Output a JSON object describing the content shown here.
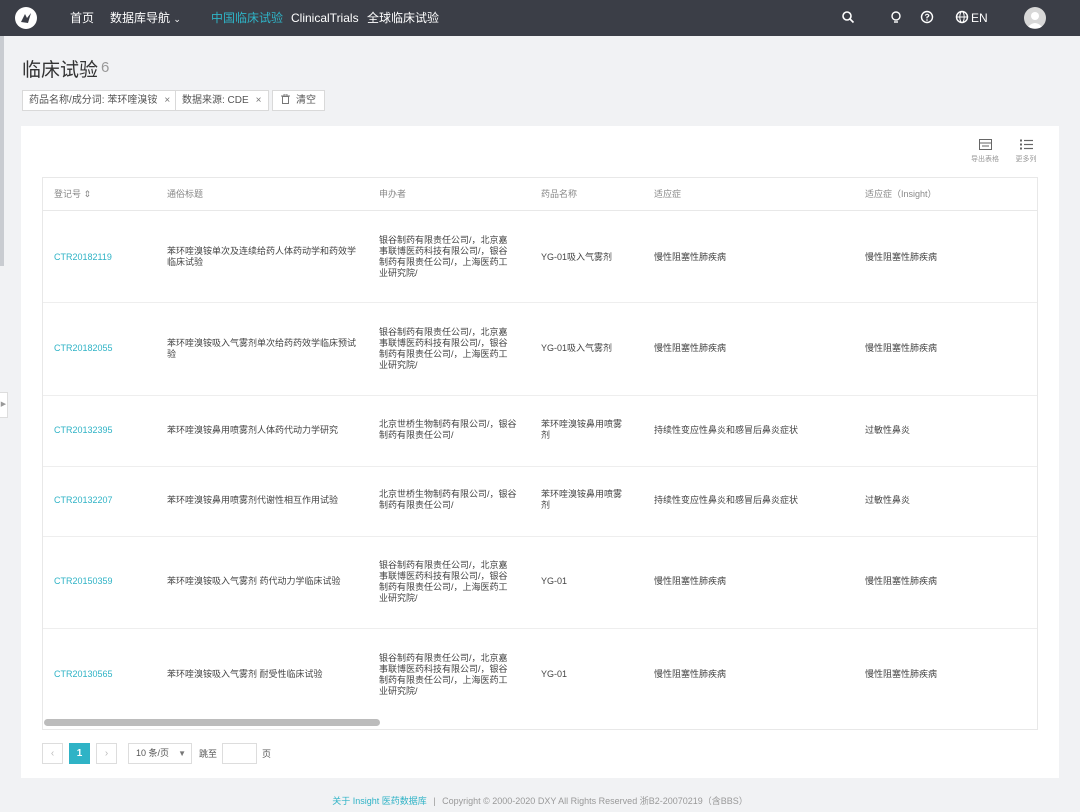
{
  "nav": {
    "items": [
      {
        "label": "首页"
      },
      {
        "label": "数据库导航"
      },
      {
        "label": "中国临床试验"
      },
      {
        "label": "ClinicalTrials"
      },
      {
        "label": "全球临床试验"
      }
    ],
    "dropdown_caret": "⌄",
    "lang": "EN",
    "icons": [
      "search-icon",
      "bulb-icon",
      "help-icon",
      "globe-icon"
    ],
    "accent_color": "#2fb3c6"
  },
  "page": {
    "title": "临床试验",
    "count": "6"
  },
  "filters": [
    {
      "label": "药品名称/成分词: 苯环喹溴铵"
    },
    {
      "label": "数据来源: CDE"
    }
  ],
  "clear_label": "清空",
  "close_glyph": "×",
  "toolbar": {
    "export_label": "导出表格",
    "columns_label": "更多列"
  },
  "table": {
    "columns": [
      "登记号 ⇕",
      "通俗标题",
      "申办者",
      "药品名称",
      "适应症",
      "适应症（Insight）"
    ],
    "rows": [
      {
        "id": "CTR20182119",
        "title": "苯环喹溴铵单次及连续给药人体药动学和药效学临床试验",
        "sponsor": "银谷制药有限责任公司/，北京嘉事联博医药科技有限公司/，银谷制药有限责任公司/，上海医药工业研究院/",
        "drug": "YG-01吸入气雾剂",
        "indication": "慢性阻塞性肺疾病",
        "insight": "慢性阻塞性肺疾病"
      },
      {
        "id": "CTR20182055",
        "title": "苯环喹溴铵吸入气雾剂单次给药药效学临床预试验",
        "sponsor": "银谷制药有限责任公司/，北京嘉事联博医药科技有限公司/，银谷制药有限责任公司/，上海医药工业研究院/",
        "drug": "YG-01吸入气雾剂",
        "indication": "慢性阻塞性肺疾病",
        "insight": "慢性阻塞性肺疾病"
      },
      {
        "id": "CTR20132395",
        "title": "苯环喹溴铵鼻用喷雾剂人体药代动力学研究",
        "sponsor": "北京世桥生物制药有限公司/，银谷制药有限责任公司/",
        "drug": "苯环喹溴铵鼻用喷雾剂",
        "indication": "持续性变应性鼻炎和感冒后鼻炎症状",
        "insight": "过敏性鼻炎"
      },
      {
        "id": "CTR20132207",
        "title": "苯环喹溴铵鼻用喷雾剂代谢性相互作用试验",
        "sponsor": "北京世桥生物制药有限公司/，银谷制药有限责任公司/",
        "drug": "苯环喹溴铵鼻用喷雾剂",
        "indication": "持续性变应性鼻炎和感冒后鼻炎症状",
        "insight": "过敏性鼻炎"
      },
      {
        "id": "CTR20150359",
        "title": "苯环喹溴铵吸入气雾剂 药代动力学临床试验",
        "sponsor": "银谷制药有限责任公司/，北京嘉事联博医药科技有限公司/，银谷制药有限责任公司/，上海医药工业研究院/",
        "drug": "YG-01",
        "indication": "慢性阻塞性肺疾病",
        "insight": "慢性阻塞性肺疾病"
      },
      {
        "id": "CTR20130565",
        "title": "苯环喹溴铵吸入气雾剂 耐受性临床试验",
        "sponsor": "银谷制药有限责任公司/，北京嘉事联博医药科技有限公司/，银谷制药有限责任公司/，上海医药工业研究院/",
        "drug": "YG-01",
        "indication": "慢性阻塞性肺疾病",
        "insight": "慢性阻塞性肺疾病"
      }
    ]
  },
  "pagination": {
    "prev": "‹",
    "current": "1",
    "next": "›",
    "page_size": "10 条/页",
    "goto_label": "跳至",
    "page_suffix": "页"
  },
  "footer": {
    "about": "关于 Insight 医药数据库",
    "separator": "|",
    "copyright": "Copyright © 2000-2020 DXY All Rights Reserved  浙B2-20070219（含BBS）"
  }
}
